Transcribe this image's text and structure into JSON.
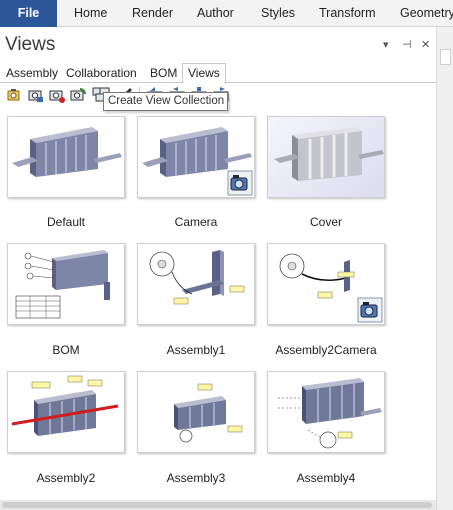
{
  "menubar": {
    "items": [
      {
        "label": "File",
        "active": true
      },
      {
        "label": "Home"
      },
      {
        "label": "Render"
      },
      {
        "label": "Author"
      },
      {
        "label": "Styles"
      },
      {
        "label": "Transform"
      },
      {
        "label": "Geometry"
      }
    ],
    "accent_color": "#2b579a"
  },
  "panel": {
    "title": "Views",
    "controls": {
      "dropdown": "▾",
      "pin": "⊣",
      "close": "✕"
    }
  },
  "tabs": [
    {
      "label": "Assembly"
    },
    {
      "label": "Collaboration"
    },
    {
      "label": "BOM"
    },
    {
      "label": "Views",
      "active": true
    }
  ],
  "toolbar": {
    "buttons": [
      "create-view-icon",
      "create-camera-view-icon",
      "record-view-icon",
      "update-view-icon",
      "create-view-collection-icon",
      "paint-brush-icon",
      "first-view-icon",
      "previous-view-icon",
      "stop-view-icon",
      "next-view-icon"
    ],
    "tooltip": "Create View Collection"
  },
  "views": [
    {
      "label": "Default",
      "kind": "assembly",
      "camera": false
    },
    {
      "label": "Camera",
      "kind": "assembly",
      "camera": true
    },
    {
      "label": "Cover",
      "kind": "cover",
      "camera": false
    },
    {
      "label": "BOM",
      "kind": "bom",
      "camera": false
    },
    {
      "label": "Assembly1",
      "kind": "bracket",
      "camera": false
    },
    {
      "label": "Assembly2Camera",
      "kind": "bracket2",
      "camera": true
    },
    {
      "label": "Assembly2",
      "kind": "red",
      "camera": false
    },
    {
      "label": "Assembly3",
      "kind": "small",
      "camera": false
    },
    {
      "label": "Assembly4",
      "kind": "exploded",
      "camera": false
    }
  ]
}
